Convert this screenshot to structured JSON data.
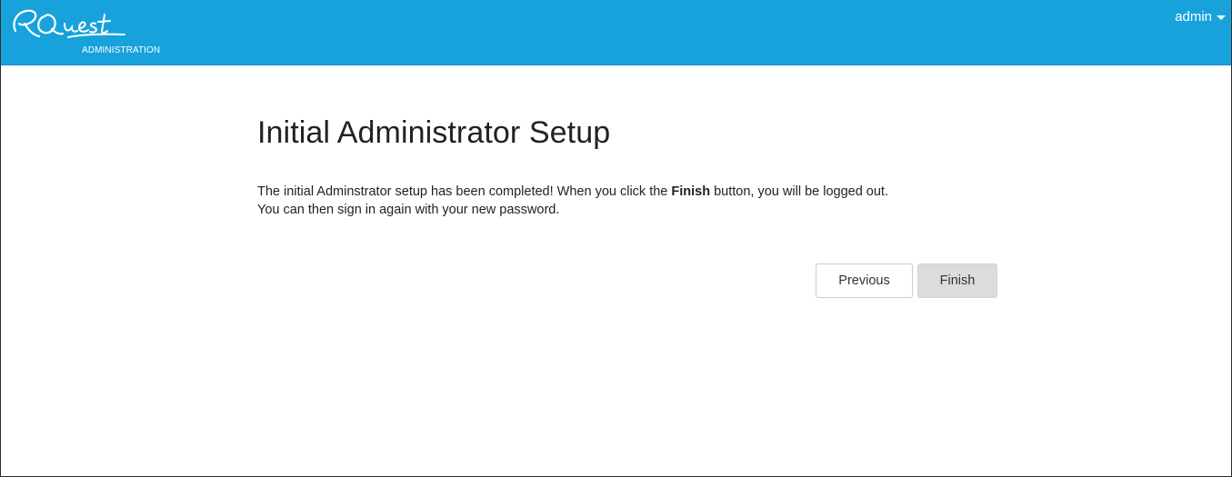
{
  "header": {
    "logo_text": "RQuest",
    "logo_subtitle": "ADMINISTRATION",
    "user_menu_label": "admin",
    "bar_color": "#17a2dc"
  },
  "main": {
    "title": "Initial Administrator Setup",
    "message": {
      "part1": "The initial Adminstrator setup has been completed! When you click the ",
      "bold": "Finish",
      "part2": " button, you will be logged out.",
      "line2": "You can then sign in again with your new password."
    },
    "buttons": {
      "previous_label": "Previous",
      "finish_label": "Finish"
    }
  }
}
